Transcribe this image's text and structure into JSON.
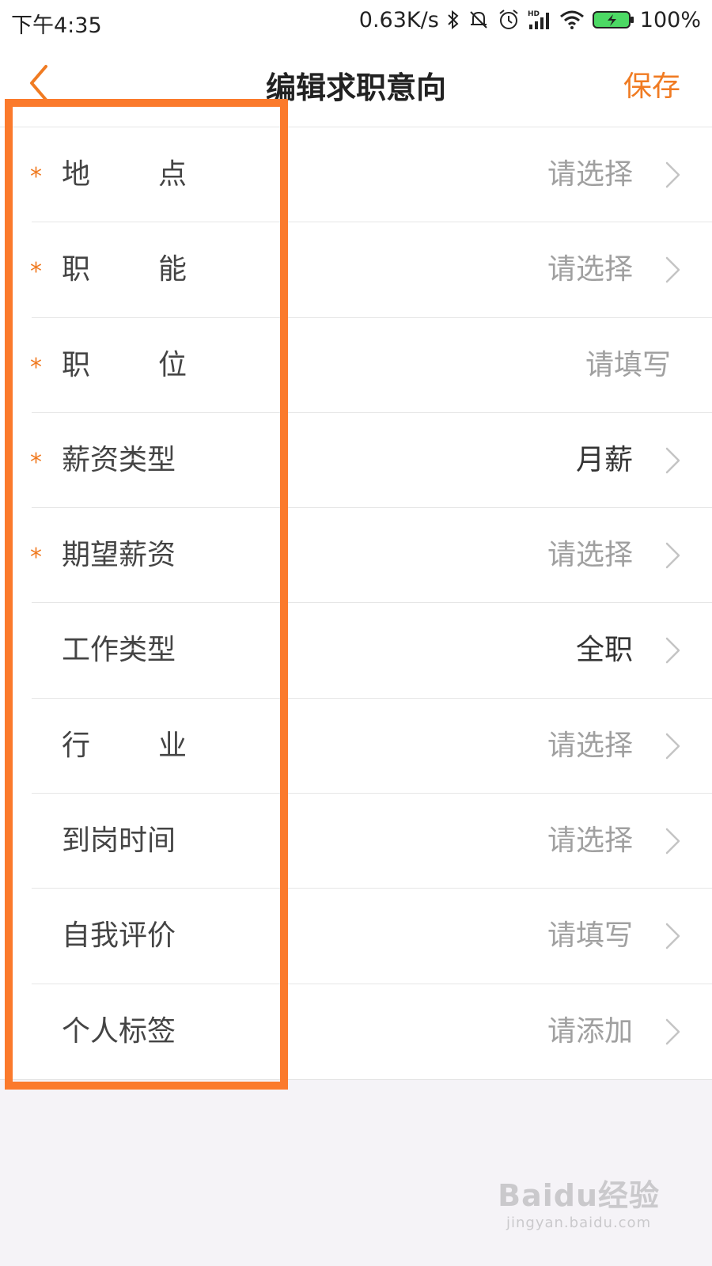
{
  "status_bar": {
    "time": "下午4:35",
    "speed": "0.63K/s",
    "signal_badge": "HD",
    "battery": "100%",
    "icons": [
      "bluetooth-icon",
      "mute-bell-icon",
      "alarm-icon",
      "signal-icon",
      "wifi-icon",
      "battery-icon"
    ]
  },
  "header": {
    "title": "编辑求职意向",
    "save": "保存",
    "back_icon": "chevron-left-icon"
  },
  "accent_color": "#f07b22",
  "highlight_color": "#fb7a2c",
  "required_mark": "*",
  "form": [
    {
      "label_chars": [
        "地",
        "点"
      ],
      "value": "请选择",
      "required": true,
      "chevron": true,
      "filled": false
    },
    {
      "label_chars": [
        "职",
        "能"
      ],
      "value": "请选择",
      "required": true,
      "chevron": true,
      "filled": false
    },
    {
      "label_chars": [
        "职",
        "位"
      ],
      "value": "请填写",
      "required": true,
      "chevron": false,
      "filled": false
    },
    {
      "label": "薪资类型",
      "value": "月薪",
      "required": true,
      "chevron": true,
      "filled": true
    },
    {
      "label": "期望薪资",
      "value": "请选择",
      "required": true,
      "chevron": true,
      "filled": false
    },
    {
      "label": "工作类型",
      "value": "全职",
      "required": false,
      "chevron": true,
      "filled": true
    },
    {
      "label_chars": [
        "行",
        "业"
      ],
      "value": "请选择",
      "required": false,
      "chevron": true,
      "filled": false
    },
    {
      "label": "到岗时间",
      "value": "请选择",
      "required": false,
      "chevron": true,
      "filled": false
    },
    {
      "label": "自我评价",
      "value": "请填写",
      "required": false,
      "chevron": true,
      "filled": false
    },
    {
      "label": "个人标签",
      "value": "请添加",
      "required": false,
      "chevron": true,
      "filled": false
    }
  ],
  "watermark": {
    "logo": "Baidu经验",
    "url": "jingyan.baidu.com"
  }
}
